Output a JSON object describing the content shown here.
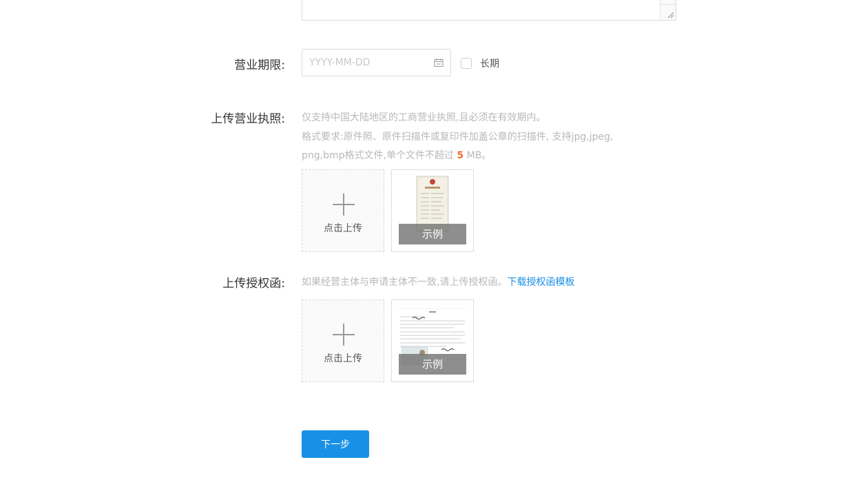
{
  "business_period": {
    "label": "营业期限:",
    "date_placeholder": "YYYY-MM-DD",
    "date_value": "",
    "long_term_label": "长期",
    "long_term_checked": false
  },
  "license_upload": {
    "label": "上传营业执照:",
    "hint_line1": "仅支持中国大陆地区的工商营业执照,且必须在有效期内。",
    "hint_line2": "格式要求:原件照、原件扫描件或复印件加盖公章的扫描件, 支持jpg,jpeg,",
    "hint_line3_prefix": "png,bmp格式文件,单个文件不超过 ",
    "hint_line3_size": "5",
    "hint_line3_suffix": " MB。",
    "upload_text": "点击上传",
    "example_label": "示例"
  },
  "auth_upload": {
    "label": "上传授权函:",
    "hint_text": "如果经营主体与申请主体不一致,请上传授权函。",
    "download_link": "下载授权函模板",
    "upload_text": "点击上传",
    "example_label": "示例"
  },
  "actions": {
    "next_label": "下一步"
  },
  "colors": {
    "primary": "#1890e6",
    "accent": "#f56c2d",
    "hint": "#b8b8b8"
  },
  "icons": {
    "date": "calendar-icon",
    "upload": "plus-icon",
    "resize": "resize-handle-icon"
  }
}
